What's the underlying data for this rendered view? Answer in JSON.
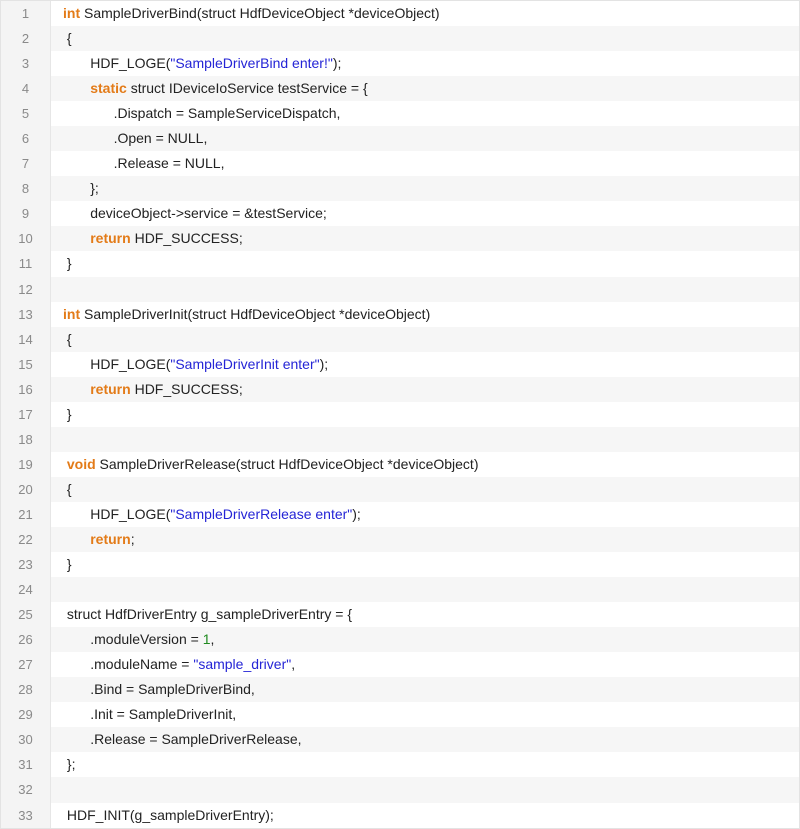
{
  "colors": {
    "keyword": "#e37b18",
    "string": "#2424d6",
    "number": "#1f8a1f",
    "text": "#222222",
    "line_number": "#8a8a8a",
    "gutter_bg": "#f4f4f4",
    "alt_row_bg": "#f6f6f6"
  },
  "code_lines": [
    {
      "number": "1",
      "segments": [
        {
          "t": "kw",
          "v": "int"
        },
        {
          "t": "plain",
          "v": " SampleDriverBind(struct HdfDeviceObject *deviceObject)"
        }
      ]
    },
    {
      "number": "2",
      "segments": [
        {
          "t": "plain",
          "v": " {"
        }
      ]
    },
    {
      "number": "3",
      "segments": [
        {
          "t": "plain",
          "v": "       HDF_LOGE("
        },
        {
          "t": "str",
          "v": "\"SampleDriverBind enter!\""
        },
        {
          "t": "plain",
          "v": ");"
        }
      ]
    },
    {
      "number": "4",
      "segments": [
        {
          "t": "plain",
          "v": "       "
        },
        {
          "t": "kw",
          "v": "static"
        },
        {
          "t": "plain",
          "v": " struct IDeviceIoService testService = {"
        }
      ]
    },
    {
      "number": "5",
      "segments": [
        {
          "t": "plain",
          "v": "             .Dispatch = SampleServiceDispatch,"
        }
      ]
    },
    {
      "number": "6",
      "segments": [
        {
          "t": "plain",
          "v": "             .Open = NULL,"
        }
      ]
    },
    {
      "number": "7",
      "segments": [
        {
          "t": "plain",
          "v": "             .Release = NULL,"
        }
      ]
    },
    {
      "number": "8",
      "segments": [
        {
          "t": "plain",
          "v": "       };"
        }
      ]
    },
    {
      "number": "9",
      "segments": [
        {
          "t": "plain",
          "v": "       deviceObject->service = &testService;"
        }
      ]
    },
    {
      "number": "10",
      "segments": [
        {
          "t": "plain",
          "v": "       "
        },
        {
          "t": "kw",
          "v": "return"
        },
        {
          "t": "plain",
          "v": " HDF_SUCCESS;"
        }
      ]
    },
    {
      "number": "11",
      "segments": [
        {
          "t": "plain",
          "v": " }"
        }
      ]
    },
    {
      "number": "12",
      "segments": [
        {
          "t": "plain",
          "v": ""
        }
      ]
    },
    {
      "number": "13",
      "segments": [
        {
          "t": "kw",
          "v": "int"
        },
        {
          "t": "plain",
          "v": " SampleDriverInit(struct HdfDeviceObject *deviceObject)"
        }
      ]
    },
    {
      "number": "14",
      "segments": [
        {
          "t": "plain",
          "v": " {"
        }
      ]
    },
    {
      "number": "15",
      "segments": [
        {
          "t": "plain",
          "v": "       HDF_LOGE("
        },
        {
          "t": "str",
          "v": "\"SampleDriverInit enter\""
        },
        {
          "t": "plain",
          "v": ");"
        }
      ]
    },
    {
      "number": "16",
      "segments": [
        {
          "t": "plain",
          "v": "       "
        },
        {
          "t": "kw",
          "v": "return"
        },
        {
          "t": "plain",
          "v": " HDF_SUCCESS;"
        }
      ]
    },
    {
      "number": "17",
      "segments": [
        {
          "t": "plain",
          "v": " }"
        }
      ]
    },
    {
      "number": "18",
      "segments": [
        {
          "t": "plain",
          "v": ""
        }
      ]
    },
    {
      "number": "19",
      "segments": [
        {
          "t": "plain",
          "v": " "
        },
        {
          "t": "kw",
          "v": "void"
        },
        {
          "t": "plain",
          "v": " SampleDriverRelease(struct HdfDeviceObject *deviceObject)"
        }
      ]
    },
    {
      "number": "20",
      "segments": [
        {
          "t": "plain",
          "v": " {"
        }
      ]
    },
    {
      "number": "21",
      "segments": [
        {
          "t": "plain",
          "v": "       HDF_LOGE("
        },
        {
          "t": "str",
          "v": "\"SampleDriverRelease enter\""
        },
        {
          "t": "plain",
          "v": ");"
        }
      ]
    },
    {
      "number": "22",
      "segments": [
        {
          "t": "plain",
          "v": "       "
        },
        {
          "t": "kw",
          "v": "return"
        },
        {
          "t": "plain",
          "v": ";"
        }
      ]
    },
    {
      "number": "23",
      "segments": [
        {
          "t": "plain",
          "v": " }"
        }
      ]
    },
    {
      "number": "24",
      "segments": [
        {
          "t": "plain",
          "v": ""
        }
      ]
    },
    {
      "number": "25",
      "segments": [
        {
          "t": "plain",
          "v": " struct HdfDriverEntry g_sampleDriverEntry = {"
        }
      ]
    },
    {
      "number": "26",
      "segments": [
        {
          "t": "plain",
          "v": "       .moduleVersion = "
        },
        {
          "t": "num",
          "v": "1"
        },
        {
          "t": "plain",
          "v": ","
        }
      ]
    },
    {
      "number": "27",
      "segments": [
        {
          "t": "plain",
          "v": "       .moduleName = "
        },
        {
          "t": "str",
          "v": "\"sample_driver\""
        },
        {
          "t": "plain",
          "v": ","
        }
      ]
    },
    {
      "number": "28",
      "segments": [
        {
          "t": "plain",
          "v": "       .Bind = SampleDriverBind,"
        }
      ]
    },
    {
      "number": "29",
      "segments": [
        {
          "t": "plain",
          "v": "       .Init = SampleDriverInit,"
        }
      ]
    },
    {
      "number": "30",
      "segments": [
        {
          "t": "plain",
          "v": "       .Release = SampleDriverRelease,"
        }
      ]
    },
    {
      "number": "31",
      "segments": [
        {
          "t": "plain",
          "v": " };"
        }
      ]
    },
    {
      "number": "32",
      "segments": [
        {
          "t": "plain",
          "v": ""
        }
      ]
    },
    {
      "number": "33",
      "segments": [
        {
          "t": "plain",
          "v": " HDF_INIT(g_sampleDriverEntry);"
        }
      ]
    }
  ]
}
